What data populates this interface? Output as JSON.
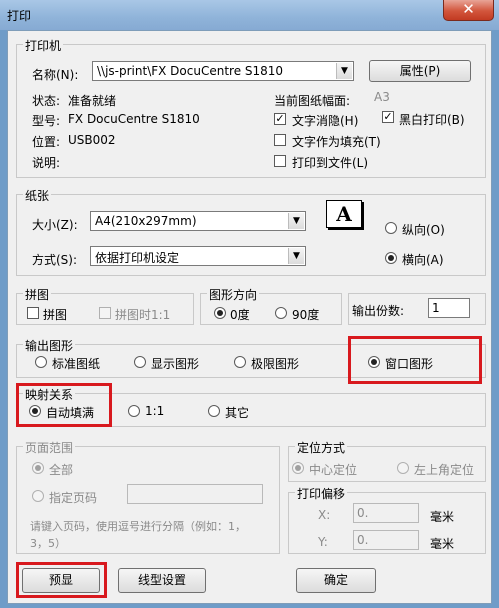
{
  "window": {
    "title": "打印",
    "close_glyph": "✕"
  },
  "printer": {
    "legend": "打印机",
    "name_label": "名称(N):",
    "name_value": "\\\\js-print\\FX DocuCentre S1810",
    "properties_button": "属性(P)",
    "status_label": "状态:",
    "status_value": "准备就绪",
    "type_label": "型号:",
    "type_value": "FX DocuCentre S1810",
    "location_label": "位置:",
    "location_value": "USB002",
    "comment_label": "说明:",
    "paper_size_label": "当前图纸幅面:",
    "paper_size_value": "A3",
    "text_hiding": {
      "label": "文字消隐(H)",
      "checked": true
    },
    "bw_print": {
      "label": "黑白打印(B)",
      "checked": true
    },
    "text_as_fill": {
      "label": "文字作为填充(T)",
      "checked": false
    },
    "print_to_file": {
      "label": "打印到文件(L)",
      "checked": false
    }
  },
  "paper": {
    "legend": "纸张",
    "size_label": "大小(Z):",
    "size_value": "A4(210x297mm)",
    "method_label": "方式(S):",
    "method_value": "依据打印机设定",
    "portrait": {
      "label": "纵向(O)",
      "selected": false
    },
    "landscape": {
      "label": "横向(A)",
      "selected": true
    },
    "orientation_icon": "A"
  },
  "tiling": {
    "legend": "拼图",
    "tile": {
      "label": "拼图",
      "checked": false
    },
    "tile_1to1": {
      "label": "拼图时1:1",
      "checked": false
    }
  },
  "rotation": {
    "legend": "图形方向",
    "deg0": {
      "label": "0度",
      "selected": true
    },
    "deg90": {
      "label": "90度",
      "selected": false
    }
  },
  "copies": {
    "label": "输出份数:",
    "value": "1"
  },
  "output": {
    "legend": "输出图形",
    "standard": {
      "label": "标准图纸",
      "selected": false
    },
    "display": {
      "label": "显示图形",
      "selected": false
    },
    "limits": {
      "label": "极限图形",
      "selected": false
    },
    "window": {
      "label": "窗口图形",
      "selected": true
    }
  },
  "mapping": {
    "legend": "映射关系",
    "autofit": {
      "label": "自动填满",
      "selected": true
    },
    "one_to_one": {
      "label": "1:1",
      "selected": false
    },
    "other": {
      "label": "其它",
      "selected": false
    }
  },
  "page_range": {
    "legend": "页面范围",
    "all": {
      "label": "全部",
      "selected": true
    },
    "specify": {
      "label": "指定页码",
      "selected": false
    },
    "hint": "请键入页码，使用逗号进行分隔（例如：1，3，5）"
  },
  "positioning": {
    "legend": "定位方式",
    "center": {
      "label": "中心定位",
      "selected": true
    },
    "topleft": {
      "label": "左上角定位",
      "selected": false
    }
  },
  "offset": {
    "legend": "打印偏移",
    "x_label": "X:",
    "x_value": "0.",
    "y_label": "Y:",
    "y_value": "0.",
    "unit": "毫米"
  },
  "buttons": {
    "preview": "预显",
    "line_settings": "线型设置",
    "ok": "确定"
  }
}
